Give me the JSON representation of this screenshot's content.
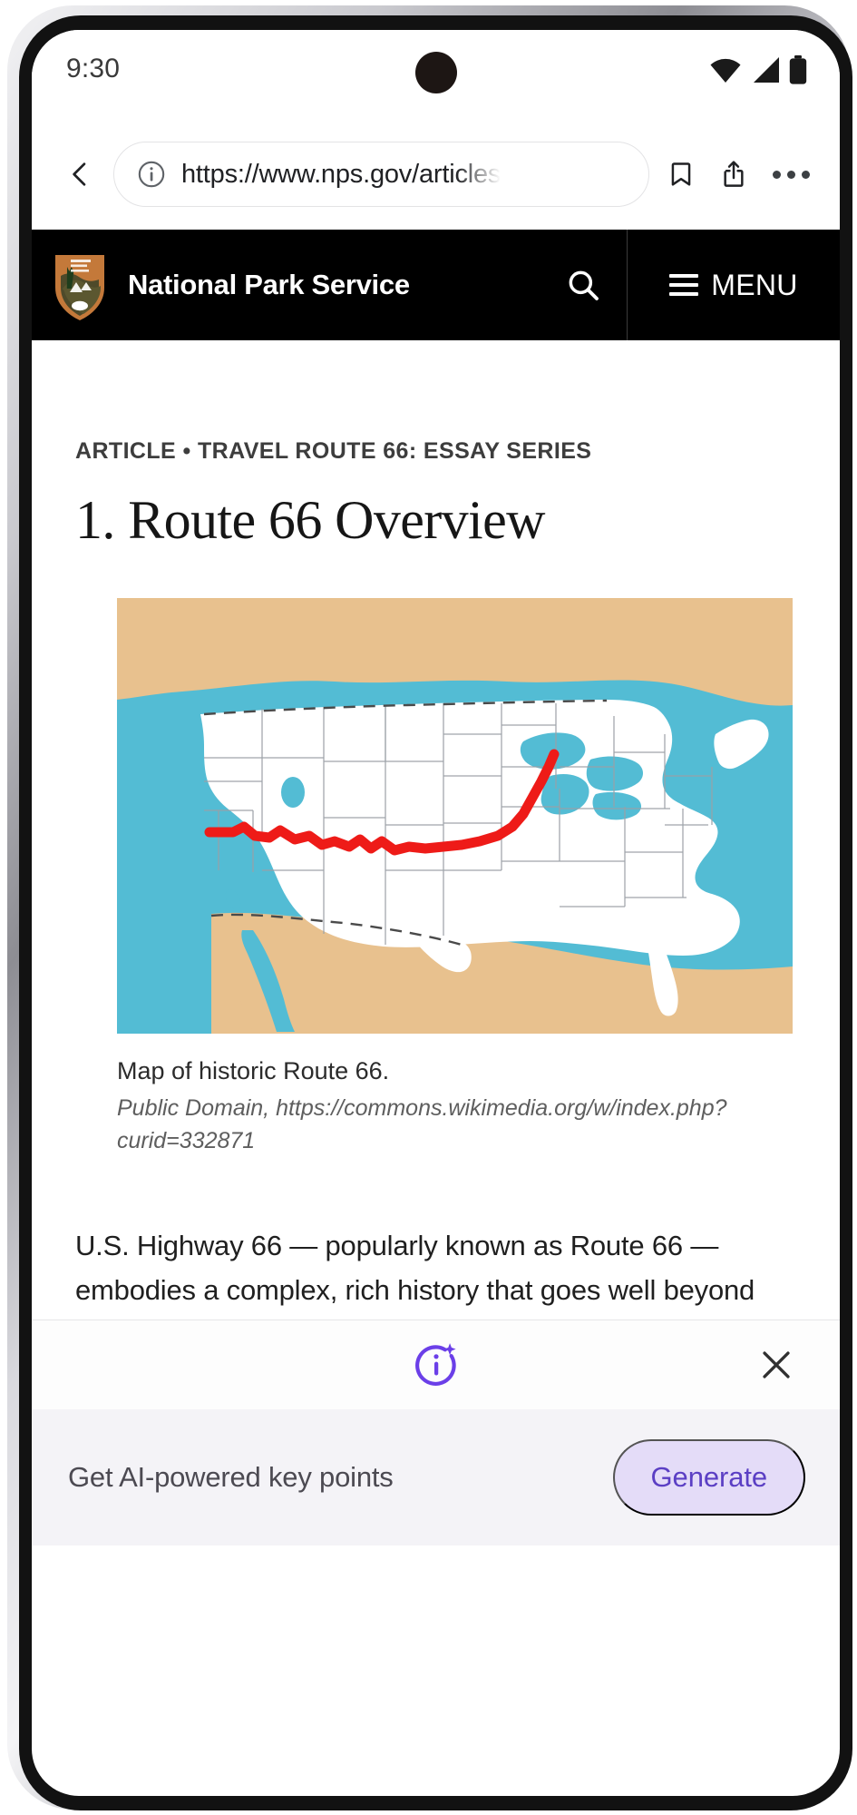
{
  "status_bar": {
    "time": "9:30",
    "icons": [
      "wifi-icon",
      "cellular-signal-icon",
      "battery-icon"
    ]
  },
  "browser": {
    "back_icon": "chevron-left-icon",
    "site_info_icon": "info-circle-icon",
    "url": "https://www.nps.gov/articles",
    "bookmark_icon": "bookmark-icon",
    "share_icon": "share-icon",
    "overflow_icon": "more-vertical-icon"
  },
  "site_header": {
    "logo_icon": "nps-arrowhead-logo-icon",
    "title": "National Park Service",
    "search_icon": "search-icon",
    "menu_icon": "hamburger-menu-icon",
    "menu_label": "MENU"
  },
  "article": {
    "kicker": "ARTICLE • TRAVEL ROUTE 66: ESSAY SERIES",
    "title": "1. Route 66 Overview",
    "figure": {
      "caption": "Map of historic Route 66.",
      "credit": "Public Domain, https://commons.wikimedia.org/w/index.php?curid=332871",
      "alt": "map-of-united-states-with-route-66-highlighted-in-red"
    },
    "body": "U.S. Highway 66 — popularly known as Route 66 — embodies a complex, rich history that goes well beyond any chronicle of the road itself. An artery of"
  },
  "ai_sheet": {
    "sparkle_icon": "ai-info-sparkle-icon",
    "close_icon": "close-icon",
    "prompt_label": "Get AI-powered key points",
    "generate_label": "Generate"
  },
  "colors": {
    "nps_black": "#000000",
    "ai_purple": "#6b3fe8",
    "ai_chip_bg": "#e4dcf8",
    "ai_chip_text": "#5b3fc4",
    "route_red": "#ee1b18",
    "map_water": "#53bcd4",
    "map_land_foreign": "#e8c18e",
    "map_land_us": "#ffffff"
  }
}
